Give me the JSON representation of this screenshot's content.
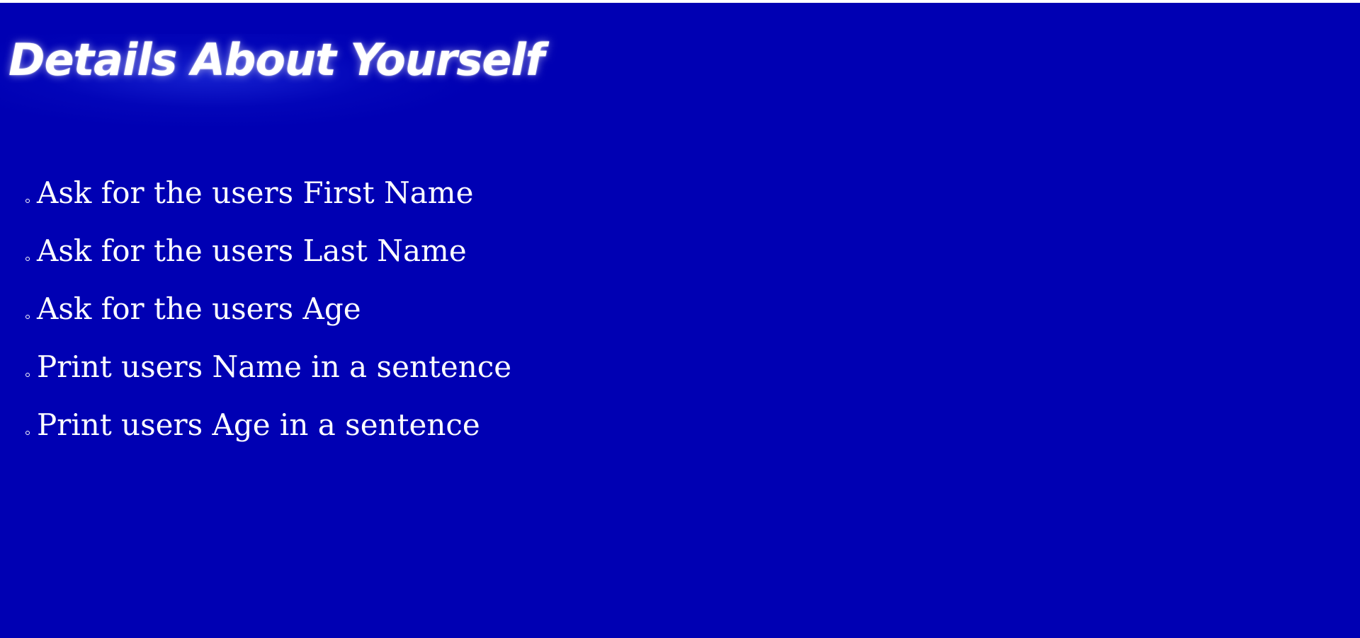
{
  "page": {
    "title": "Details About Yourself",
    "items": [
      "Ask for the users First Name",
      "Ask for the users Last Name",
      "Ask for the users Age",
      "Print users Name in a sentence",
      "Print users Age in a sentence"
    ]
  },
  "colors": {
    "background": "#0000b3",
    "text": "#ffffff"
  },
  "icons": {
    "bullet": "hollow-circle-bullet-icon"
  }
}
